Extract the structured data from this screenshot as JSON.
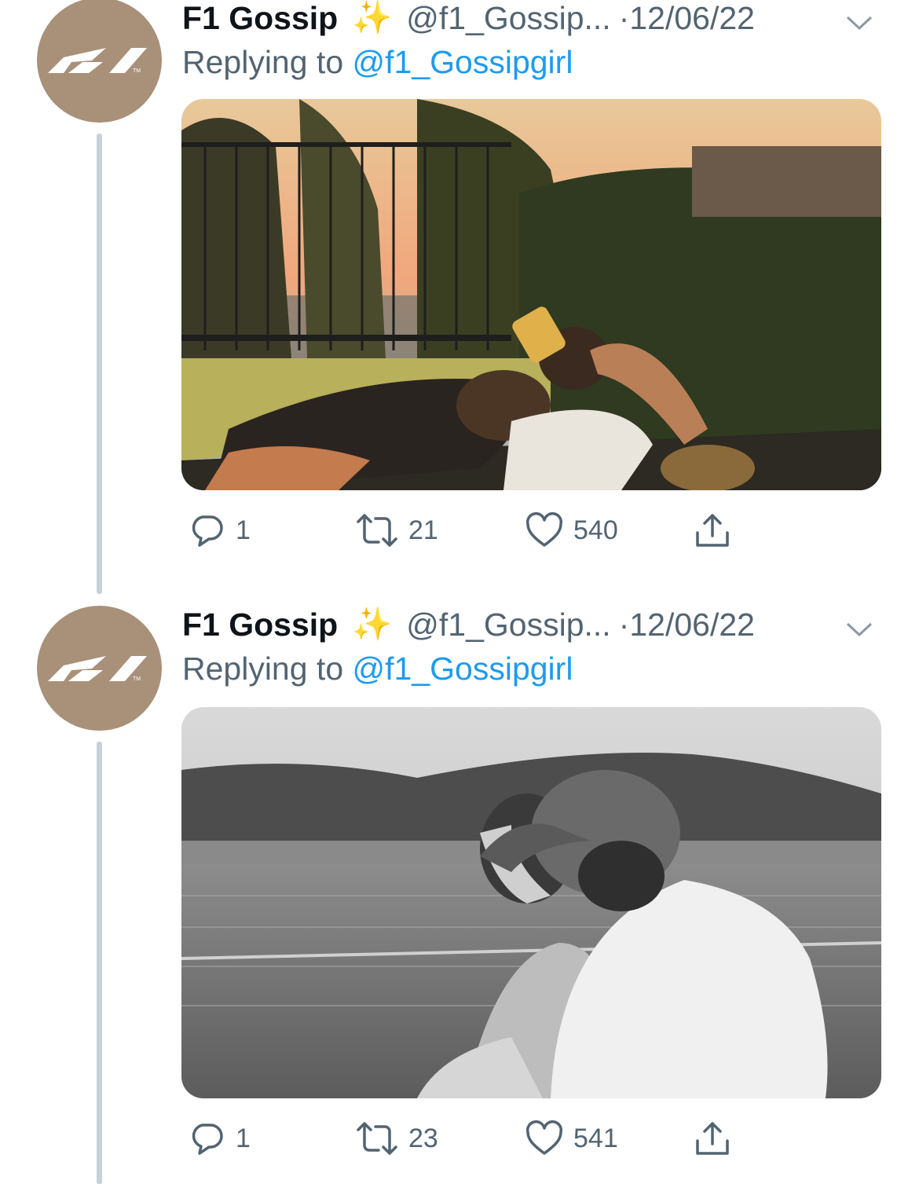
{
  "tweets": [
    {
      "author": "F1 Gossip",
      "sparkle": "✨",
      "handle": "@f1_Gossip...",
      "separator": "·",
      "date": "12/06/22",
      "replying_prefix": "Replying to",
      "replying_to": "@f1_Gossipgirl",
      "media_description": "couple lying on a daybed at sunset",
      "replies": "1",
      "retweets": "21",
      "likes": "540"
    },
    {
      "author": "F1 Gossip",
      "sparkle": "✨",
      "handle": "@f1_Gossip...",
      "separator": "·",
      "date": "12/06/22",
      "replying_prefix": "Replying to",
      "replying_to": "@f1_Gossipgirl",
      "media_description": "black and white photo of couple on a boat",
      "replies": "1",
      "retweets": "23",
      "likes": "541"
    }
  ],
  "colors": {
    "avatar_bg": "#a99079",
    "mention": "#1d9bf0",
    "muted": "#536471",
    "thread_line": "#c7d1d9"
  },
  "icons": [
    "f1-logo-icon",
    "chevron-down-icon",
    "reply-icon",
    "retweet-icon",
    "like-icon",
    "share-icon"
  ]
}
